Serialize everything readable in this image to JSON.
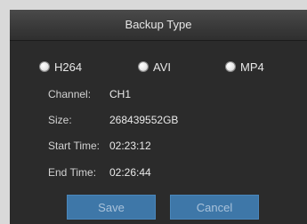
{
  "dialog": {
    "title": "Backup Type",
    "options": [
      {
        "label": "H264",
        "selected": true
      },
      {
        "label": "AVI",
        "selected": false
      },
      {
        "label": "MP4",
        "selected": false
      }
    ],
    "fields": {
      "channel": {
        "label": "Channel:",
        "value": "CH1"
      },
      "size": {
        "label": "Size:",
        "value": "268439552GB"
      },
      "start_time": {
        "label": "Start Time:",
        "value": "02:23:12"
      },
      "end_time": {
        "label": "End Time:",
        "value": "02:26:44"
      }
    },
    "buttons": {
      "save": "Save",
      "cancel": "Cancel"
    },
    "colors": {
      "background": "#2b2b2b",
      "button": "#3e77a8",
      "button_text": "#a9c2da"
    }
  }
}
